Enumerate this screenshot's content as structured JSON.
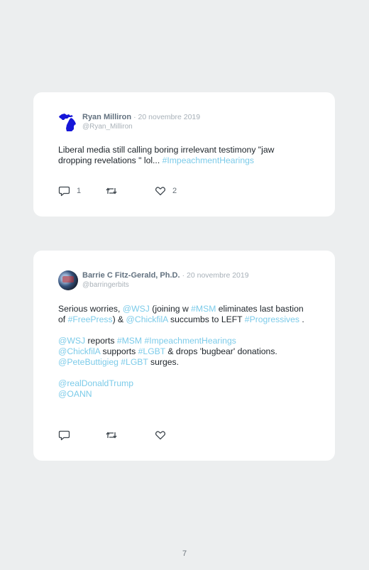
{
  "tweets": [
    {
      "name": "Ryan Milliron",
      "date": "· 20 novembre 2019",
      "handle": "@Ryan_Milliron",
      "avatar_icon": "michigan-map-icon",
      "content": [
        [
          {
            "t": "Liberal media still calling boring irrelevant testimony \"jaw dropping revelations \" lol... "
          },
          {
            "t": "#ImpeachmentHearings",
            "link": true
          }
        ]
      ],
      "replies": "1",
      "likes": "2"
    },
    {
      "name": "Barrie C Fitz-Gerald, Ph.D.",
      "date": "· 20 novembre 2019",
      "handle": "@barringerbits",
      "avatar_icon": "profile-photo",
      "content": [
        [
          {
            "t": "Serious worries, "
          },
          {
            "t": "@WSJ",
            "link": true
          },
          {
            "t": " (joining w "
          },
          {
            "t": "#MSM",
            "link": true
          },
          {
            "t": " eliminates last bastion of "
          },
          {
            "t": "#FreePress",
            "link": true
          },
          {
            "t": ") & "
          },
          {
            "t": "@ChickfilA",
            "link": true
          },
          {
            "t": " succumbs to LEFT "
          },
          {
            "t": "#Progressives",
            "link": true
          },
          {
            "t": " ."
          }
        ],
        [
          {
            "t": "@WSJ",
            "link": true
          },
          {
            "t": " reports "
          },
          {
            "t": "#MSM",
            "link": true
          },
          {
            "t": " "
          },
          {
            "t": "#ImpeachmentHearings",
            "link": true
          },
          {
            "br": true
          },
          {
            "t": "@ChickfilA",
            "link": true
          },
          {
            "t": " supports "
          },
          {
            "t": "#LGBT",
            "link": true
          },
          {
            "t": " & drops 'bugbear' donations."
          },
          {
            "br": true
          },
          {
            "t": "@PeteButtigieg",
            "link": true
          },
          {
            "t": " "
          },
          {
            "t": "#LGBT",
            "link": true
          },
          {
            "t": " surges."
          }
        ],
        [
          {
            "t": "@realDonaldTrump",
            "link": true
          },
          {
            "br": true
          },
          {
            "t": "@OANN",
            "link": true
          }
        ]
      ],
      "replies": "",
      "likes": ""
    }
  ],
  "page_number": "7",
  "colors": {
    "background": "#eceeef",
    "card": "#ffffff",
    "link": "#7ccbe9",
    "name": "#62717f",
    "muted": "#a7b0b8",
    "michigan_blue": "#1616d8"
  }
}
